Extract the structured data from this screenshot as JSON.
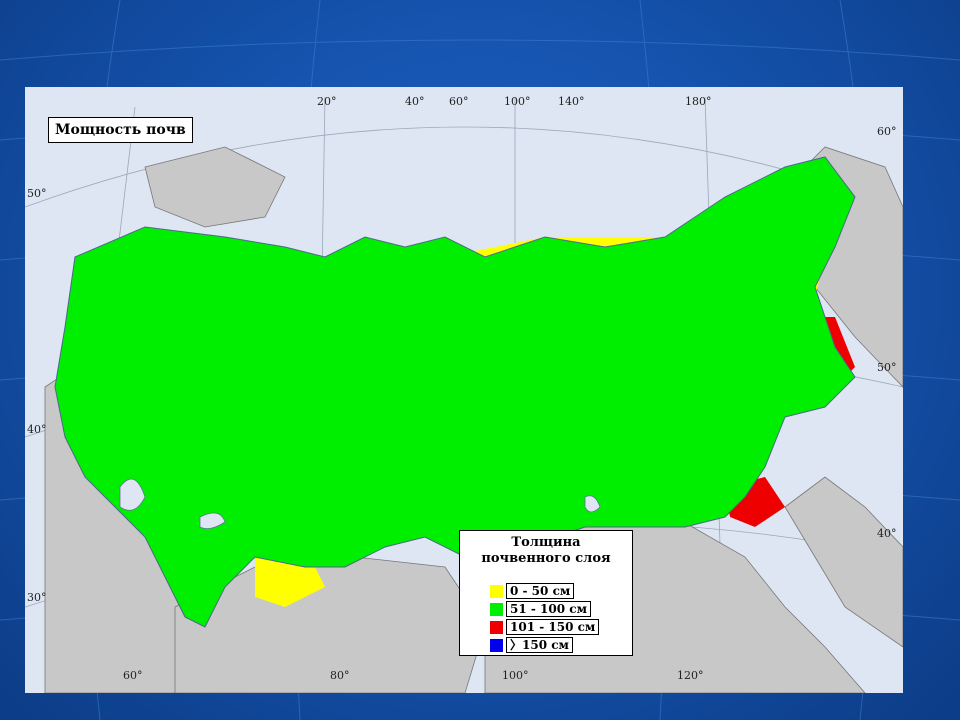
{
  "map": {
    "title": "Мощность почв",
    "colors": {
      "water": "#dde6f2",
      "land": "#c8c8c8",
      "c1": "#ffff00",
      "c2": "#00ee00",
      "c3": "#ee0000",
      "c4": "#0000ee"
    },
    "top_ticks": [
      "20°",
      "40°",
      "60°",
      "100°",
      "140°",
      "180°"
    ],
    "bottom_ticks": [
      "60°",
      "80°",
      "100°",
      "120°"
    ],
    "left_ticks": [
      "50°",
      "40°",
      "30°"
    ],
    "right_ticks": [
      "60°",
      "50°",
      "40°"
    ]
  },
  "legend": {
    "title_line1": "Толщина",
    "title_line2": "почвенного слоя",
    "items": [
      {
        "label": "0 - 50 см",
        "color": "#ffff00"
      },
      {
        "label": "51 - 100 см",
        "color": "#00ee00"
      },
      {
        "label": "101 - 150 см",
        "color": "#ee0000"
      },
      {
        "label": "〉150 см",
        "color": "#0000ee"
      }
    ]
  }
}
